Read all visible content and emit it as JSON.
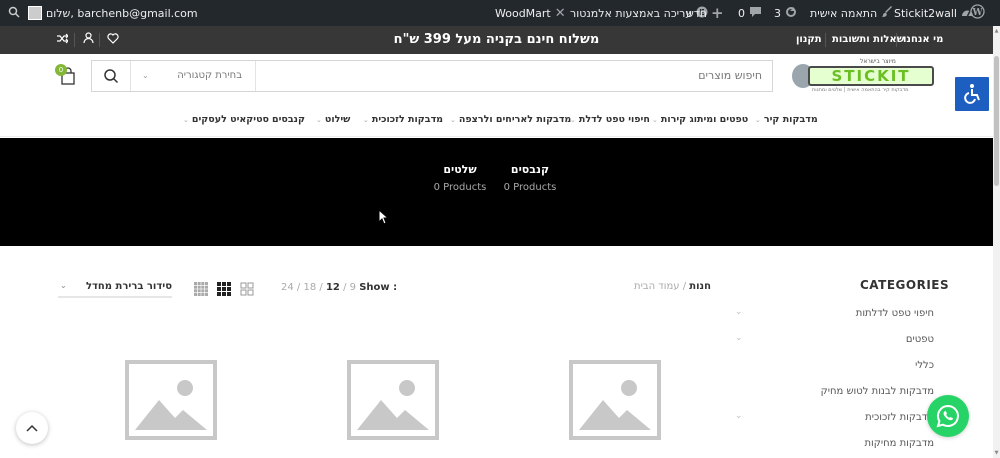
{
  "admin_bar": {
    "greeting": "שלום, barchenb@gmail.com",
    "woodmart": "WoodMart",
    "edit_elementor": "עריכה באמצעות אלמנטור",
    "new_label": "חדש",
    "comments_count": "0",
    "updates_count": "3",
    "customize": "התאמה אישית",
    "site_name": "Stickit2wall"
  },
  "top_bar": {
    "promo": "משלוח חינם בקניה מעל 399 ש\"ח",
    "links": [
      "מי אנחנו",
      "שאלות ותשובות",
      "תקנון"
    ]
  },
  "header": {
    "logo_text": "STICKIT",
    "logo_small": "מיוצר בישראל",
    "logo_tagline": "מדבקות קיר בהתאמה אישית | שלטים ומתנות",
    "search_placeholder": "חיפוש מוצרים",
    "category_select": "בחירת קטגוריה",
    "cart_count": "0"
  },
  "menu": {
    "items": [
      "מדבקות קיר",
      "טפטים ומיתוג קירות",
      "חיפוי טפט לדלת",
      "מדבקות לאריחים ולרצפה",
      "מדבקות לזכוכית",
      "שילוט",
      "קנבסים",
      "סטיקאיט לעסקים"
    ]
  },
  "banner": {
    "categories": [
      {
        "name": "קנבסים",
        "count": "0 Products"
      },
      {
        "name": "שלטים",
        "count": "0 Products"
      }
    ]
  },
  "sidebar": {
    "title": "CATEGORIES",
    "items": [
      "חיפוי טפט לדלתות",
      "טפטים",
      "כללי",
      "מדבקות לבנות לטוש מחיק",
      "מדבקות לזכוכית",
      "מדבקות מחיקות"
    ]
  },
  "shop": {
    "breadcrumb_home": "עמוד הבית",
    "breadcrumb_sep": "/",
    "breadcrumb_current": "חנות",
    "show_label": "Show :",
    "per_page": [
      "9",
      "12",
      "18",
      "24"
    ],
    "per_page_selected": "12",
    "sort_label": "סידור ברירת מחדל"
  }
}
